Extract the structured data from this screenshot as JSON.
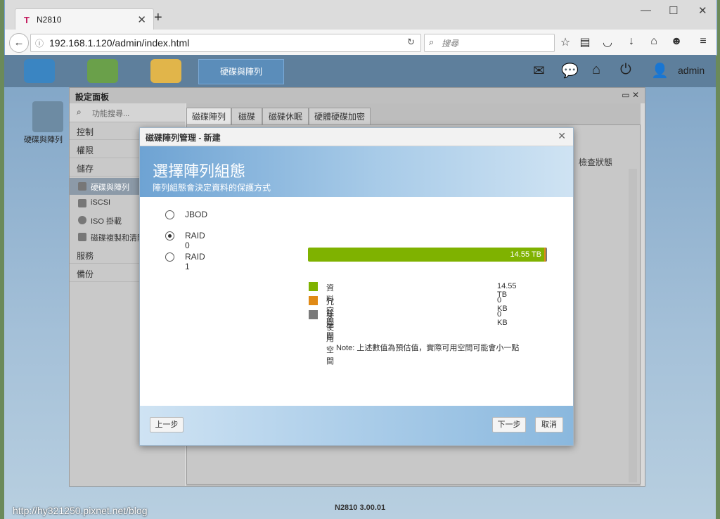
{
  "browser": {
    "tab_logo": "T",
    "tab_title": "N2810",
    "new_tab": "+",
    "url": "192.168.1.120/admin/index.html",
    "search_placeholder": "搜尋"
  },
  "app": {
    "active_app_tab": "硬碟與陣列",
    "user": "admin",
    "desktop_icon_label": "硬碟與陣列",
    "status": "N2810   3.00.01"
  },
  "settings_panel": {
    "title": "設定面板",
    "search_placeholder": "功能搜尋...",
    "sidebar": [
      {
        "label": "控制"
      },
      {
        "label": "權限"
      },
      {
        "label": "儲存"
      },
      {
        "label": "服務"
      },
      {
        "label": "備份"
      }
    ],
    "sub_items": [
      {
        "label": "硬碟與陣列"
      },
      {
        "label": "iSCSI"
      },
      {
        "label": "ISO 掛載"
      },
      {
        "label": "磁碟複製和清除"
      }
    ],
    "tabs": [
      "磁碟陣列",
      "磁碟",
      "磁碟休眠",
      "硬體硬碟加密"
    ],
    "column_header": "檢查狀態"
  },
  "modal": {
    "title": "磁碟陣列管理 - 新建",
    "heading": "選擇陣列組態",
    "subheading": "陣列組態會決定資料的保護方式",
    "options": [
      {
        "label": "JBOD",
        "checked": false
      },
      {
        "label": "RAID 0",
        "checked": true
      },
      {
        "label": "RAID 1",
        "checked": false
      }
    ],
    "bar_label": "14.55 TB",
    "bar_fraction": 0.99,
    "legend": [
      {
        "label": "資料空間",
        "value": "14.55 TB",
        "color": "#7fb200"
      },
      {
        "label": "冗餘空間",
        "value": "0 KB",
        "color": "#e08a16"
      },
      {
        "label": "未使用空間",
        "value": "0 KB",
        "color": "#7a7a7a"
      }
    ],
    "note": "Note: 上述數值為預估值，實際可用空間可能會小一點",
    "back_button": "上一步",
    "next_button": "下一步",
    "cancel_button": "取消"
  },
  "watermark": "http://hy321250.pixnet.net/blog"
}
